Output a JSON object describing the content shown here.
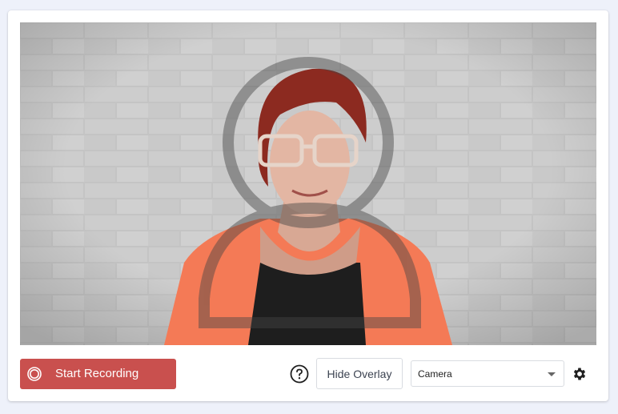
{
  "controls": {
    "record_label": "Start Recording",
    "help_icon": "question-circle-icon",
    "overlay_label": "Hide Overlay",
    "source_select": {
      "selected": "Camera"
    },
    "settings_icon": "gear-icon"
  },
  "colors": {
    "page_background": "#eef1fa",
    "record_button": "#c9504e",
    "wall": "#bdbdbd",
    "cardigan": "#f47a56",
    "hair": "#8c2a20"
  },
  "video": {
    "content": "webcam-preview",
    "overlay": "face-framing-guide"
  }
}
